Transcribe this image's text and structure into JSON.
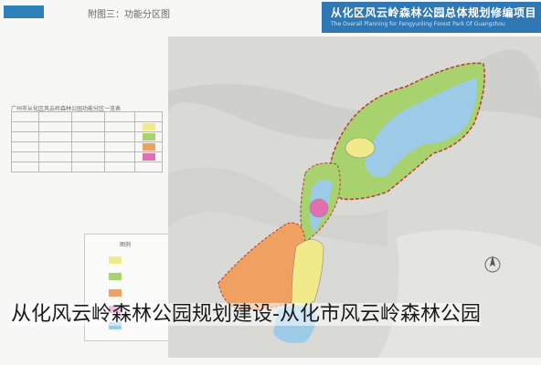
{
  "header": {
    "caption": "附图三：功能分区图",
    "title": "从化区风云岭森林公园总体规划修编项目",
    "subtitle": "The Overall Planning for Fengyunling Forest Park Of Guangzhou"
  },
  "stats_table": {
    "title": "广州市从化区风云岭森林公园功能分区一览表",
    "rows": [
      {
        "area": "",
        "pct": "",
        "color": "#f1ea8a"
      },
      {
        "area": "",
        "pct": "",
        "color": "#a7d26d"
      },
      {
        "area": "",
        "pct": "",
        "color": "#f0a060"
      },
      {
        "area": "",
        "pct": "",
        "color": "#e46fb0"
      },
      {
        "area": "",
        "pct": "",
        "color": ""
      }
    ]
  },
  "legend": {
    "title": "图例",
    "items": [
      {
        "label": "",
        "color": "#f1ea8a"
      },
      {
        "label": "",
        "color": "#a7d26d"
      },
      {
        "label": "",
        "color": "#f0a060"
      },
      {
        "label": "",
        "color": "#e46fb0"
      },
      {
        "label": "",
        "color": "#9ccbe8"
      }
    ]
  },
  "map": {
    "zone_labels": [
      "",
      "",
      "",
      ""
    ]
  },
  "overlay_caption": "从化风云岭森林公园规划建设-从化市风云岭森林公园",
  "bottom_label": ""
}
